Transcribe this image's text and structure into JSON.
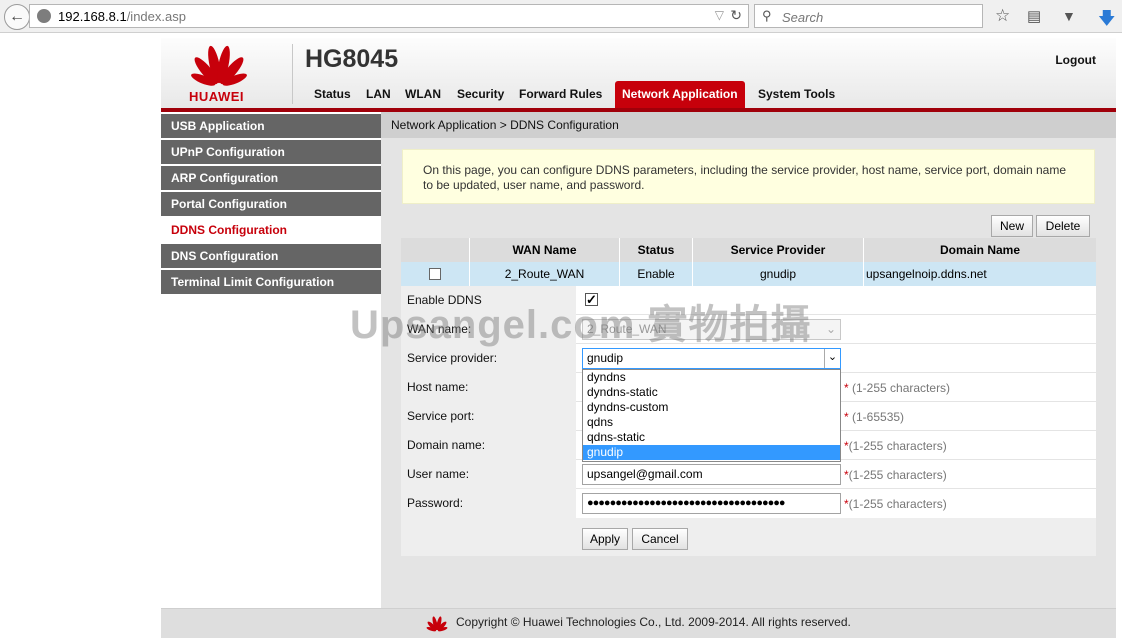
{
  "browser": {
    "url_host": "192.168.8.1",
    "url_path": "/index.asp",
    "search_placeholder": "Search",
    "icons": [
      "back-icon",
      "globe-icon",
      "dropdown-arrow-icon",
      "reload-icon",
      "search-icon",
      "star-icon",
      "reading-list-icon",
      "pocket-icon",
      "download-icon"
    ]
  },
  "header": {
    "brand": "HUAWEI",
    "model": "HG8045",
    "logout": "Logout",
    "tabs": [
      "Status",
      "LAN",
      "WLAN",
      "Security",
      "Forward Rules",
      "Network Application",
      "System Tools"
    ],
    "active_tab": "Network Application"
  },
  "sidebar": {
    "items": [
      "USB Application",
      "UPnP Configuration",
      "ARP Configuration",
      "Portal Configuration",
      "DDNS Configuration",
      "DNS Configuration",
      "Terminal Limit Configuration"
    ],
    "active": "DDNS Configuration"
  },
  "breadcrumb": "Network Application > DDNS Configuration",
  "info_text": "On this page, you can configure DDNS parameters, including the service provider, host name, service port, domain name to be updated, user name, and password.",
  "buttons": {
    "new": "New",
    "delete": "Delete",
    "apply": "Apply",
    "cancel": "Cancel"
  },
  "table": {
    "headers": [
      "WAN Name",
      "Status",
      "Service Provider",
      "Domain Name"
    ],
    "rows": [
      {
        "wan_name": "2_Route_WAN",
        "status": "Enable",
        "provider": "gnudip",
        "domain": "upsangelnoip.ddns.net",
        "checked": false
      }
    ]
  },
  "form": {
    "enable_label": "Enable DDNS",
    "enable_checked": true,
    "wan_label": "WAN name:",
    "wan_value": "2_Route_WAN",
    "provider_label": "Service provider:",
    "provider_value": "gnudip",
    "provider_options": [
      "dyndns",
      "dyndns-static",
      "dyndns-custom",
      "qdns",
      "qdns-static",
      "gnudip"
    ],
    "host_label": "Host name:",
    "host_hint": "(1-255 characters)",
    "port_label": "Service port:",
    "port_hint": "(1-65535)",
    "domain_label": "Domain name:",
    "domain_hint": "(1-255 characters)",
    "user_label": "User name:",
    "user_value": "upsangel@gmail.com",
    "user_hint": "(1-255 characters)",
    "password_label": "Password:",
    "password_value": "●●●●●●●●●●●●●●●●●●●●●●●●●●●●●●●●●●●",
    "password_hint": "(1-255 characters)",
    "required_mark": "*"
  },
  "watermark": "Upsangel.com 實物拍攝",
  "footer": "Copyright © Huawei Technologies Co., Ltd. 2009-2014. All rights reserved.",
  "colors": {
    "brand_red": "#c7000b",
    "sidebar_gray": "#656565",
    "selected_blue": "#3399ff",
    "info_bg": "#ffffe0"
  }
}
